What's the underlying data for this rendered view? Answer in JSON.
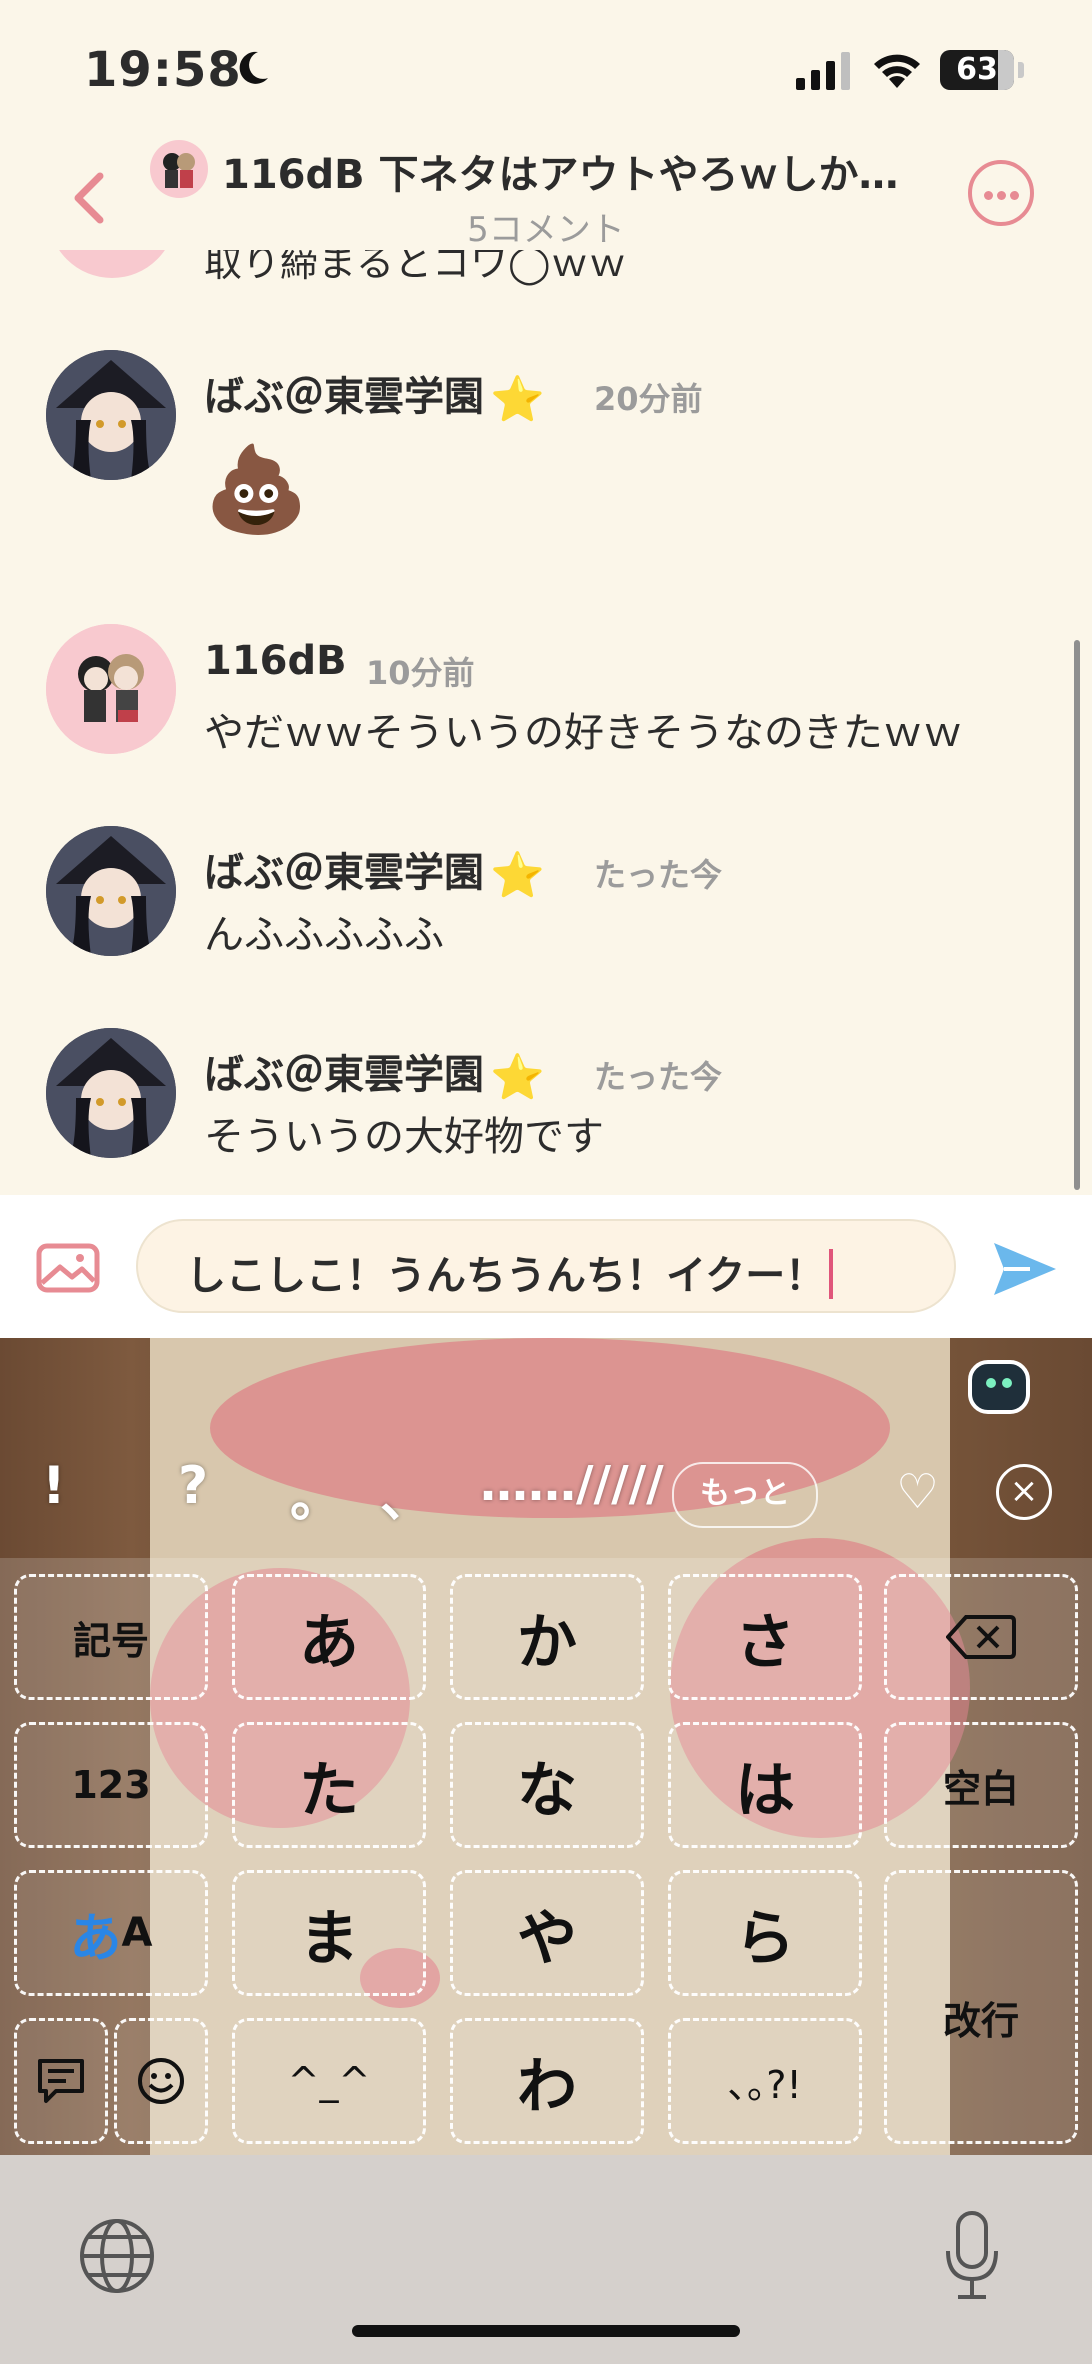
{
  "status": {
    "time": "19:58",
    "battery": "63"
  },
  "header": {
    "title": "116dB 下ネタはアウトやろｗしか…",
    "subtitle": "5コメント"
  },
  "chat": {
    "cut_text": "取り締まるとコワ◯ｗｗ",
    "messages": [
      {
        "name": "ばぶ＠東雲学園",
        "star": "⭐",
        "time": "20分前",
        "text": "💩",
        "avatar": "dark"
      },
      {
        "name": "116dB",
        "star": "",
        "time": "10分前",
        "text": "やだｗｗそういうの好きそうなのきたｗｗ",
        "avatar": "pink"
      },
      {
        "name": "ばぶ＠東雲学園",
        "star": "⭐",
        "time": "たった今",
        "text": "んふふふふふ",
        "avatar": "dark"
      },
      {
        "name": "ばぶ＠東雲学園",
        "star": "⭐",
        "time": "たった今",
        "text": "そういうの大好物です",
        "avatar": "dark"
      }
    ]
  },
  "input": {
    "value": "しこしこ！うんちうんち！イクー！"
  },
  "keyboard": {
    "candidates": [
      "!",
      "?",
      "。",
      "、",
      "……/////"
    ],
    "more": "もっと",
    "keys": {
      "symbols": "記号",
      "num": "123",
      "mode_a": "あ",
      "mode_b": "A",
      "a": "あ",
      "ka": "か",
      "sa": "さ",
      "ta": "た",
      "na": "な",
      "ha": "は",
      "ma": "ま",
      "ya": "や",
      "ra": "ら",
      "kaomoji": "^_^",
      "wa": "わ",
      "punct": "､｡?!",
      "space": "空白",
      "enter": "改行"
    }
  }
}
